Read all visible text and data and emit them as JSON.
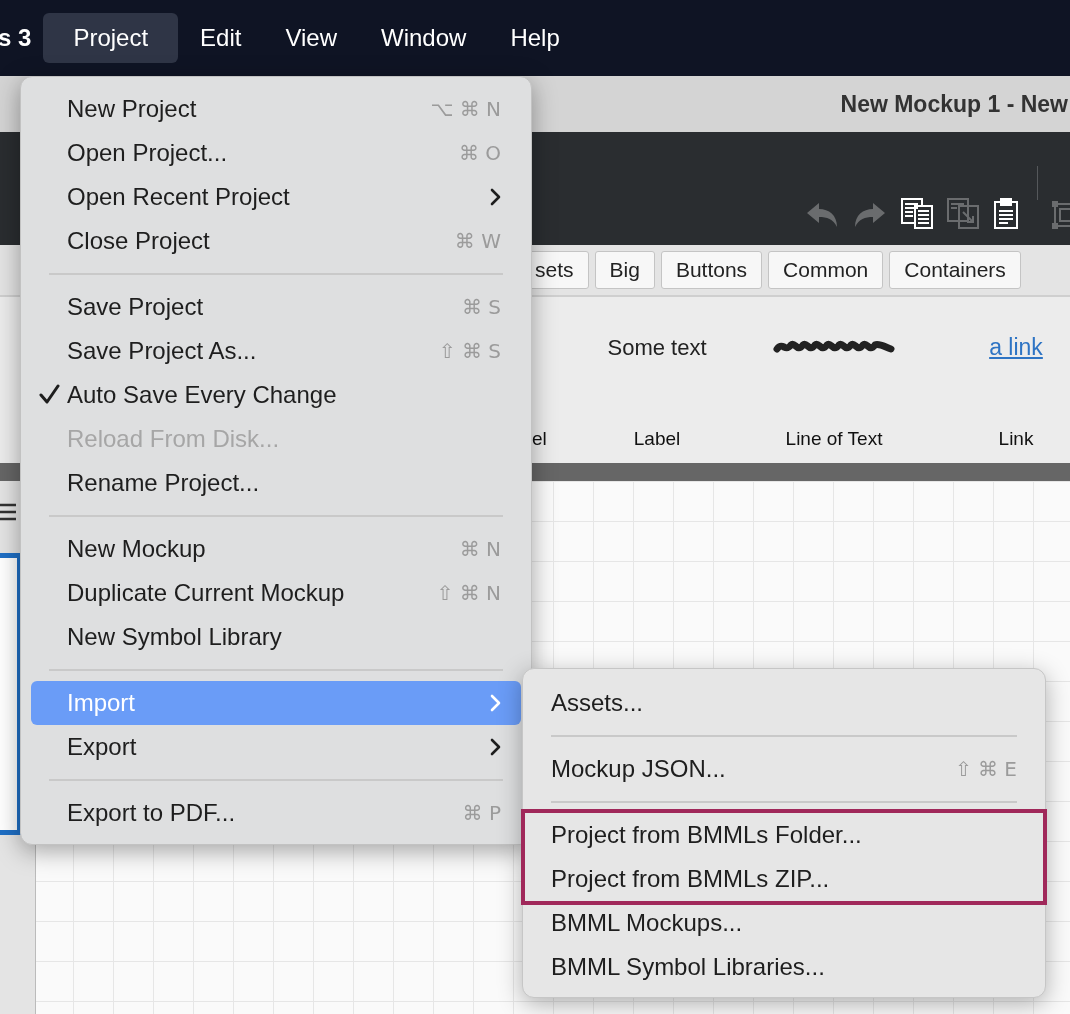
{
  "menubar": {
    "app_name": "s 3",
    "menus": [
      {
        "label": "Project",
        "selected": true
      },
      {
        "label": "Edit",
        "selected": false
      },
      {
        "label": "View",
        "selected": false
      },
      {
        "label": "Window",
        "selected": false
      },
      {
        "label": "Help",
        "selected": false
      }
    ]
  },
  "window": {
    "title": "New Mockup 1 - New"
  },
  "toolbar": {
    "tools": [
      {
        "kind": "undo",
        "disabled": true
      },
      {
        "kind": "redo",
        "disabled": true
      },
      {
        "kind": "copy",
        "disabled": false
      },
      {
        "kind": "duplicate",
        "disabled": true
      },
      {
        "kind": "paste",
        "disabled": false
      },
      {
        "kind": "separator"
      },
      {
        "kind": "group",
        "disabled": true
      }
    ]
  },
  "library_tabs": [
    {
      "label": "sets"
    },
    {
      "label": "Big"
    },
    {
      "label": "Buttons"
    },
    {
      "label": "Common"
    },
    {
      "label": "Containers"
    }
  ],
  "components": [
    {
      "kind": "hidden",
      "name": "el"
    },
    {
      "kind": "label",
      "preview": "Some text",
      "name": "Label"
    },
    {
      "kind": "line_of_text",
      "name": "Line of Text"
    },
    {
      "kind": "link",
      "preview": "a link",
      "name": "Link"
    }
  ],
  "project_menu": {
    "items": [
      {
        "kind": "item",
        "label": "New Project",
        "shortcut": "⌥ ⌘ N",
        "submenu": false,
        "checked": false,
        "disabled": false,
        "selected": false
      },
      {
        "kind": "item",
        "label": "Open Project...",
        "shortcut": "⌘ O",
        "submenu": false,
        "checked": false,
        "disabled": false,
        "selected": false
      },
      {
        "kind": "item",
        "label": "Open Recent Project",
        "submenu": true,
        "checked": false,
        "disabled": false,
        "selected": false
      },
      {
        "kind": "item",
        "label": "Close Project",
        "shortcut": "⌘ W",
        "submenu": false,
        "checked": false,
        "disabled": false,
        "selected": false
      },
      {
        "kind": "separator"
      },
      {
        "kind": "item",
        "label": "Save Project",
        "shortcut": "⌘ S",
        "submenu": false,
        "checked": false,
        "disabled": false,
        "selected": false
      },
      {
        "kind": "item",
        "label": "Save Project As...",
        "shortcut": "⇧ ⌘ S",
        "submenu": false,
        "checked": false,
        "disabled": false,
        "selected": false
      },
      {
        "kind": "item",
        "label": "Auto Save Every Change",
        "submenu": false,
        "checked": true,
        "disabled": false,
        "selected": false
      },
      {
        "kind": "item",
        "label": "Reload From Disk...",
        "submenu": false,
        "checked": false,
        "disabled": true,
        "selected": false
      },
      {
        "kind": "item",
        "label": "Rename Project...",
        "submenu": false,
        "checked": false,
        "disabled": false,
        "selected": false
      },
      {
        "kind": "separator"
      },
      {
        "kind": "item",
        "label": "New Mockup",
        "shortcut": "⌘ N",
        "submenu": false,
        "checked": false,
        "disabled": false,
        "selected": false
      },
      {
        "kind": "item",
        "label": "Duplicate Current Mockup",
        "shortcut": "⇧ ⌘ N",
        "submenu": false,
        "checked": false,
        "disabled": false,
        "selected": false
      },
      {
        "kind": "item",
        "label": "New Symbol Library",
        "submenu": false,
        "checked": false,
        "disabled": false,
        "selected": false
      },
      {
        "kind": "separator"
      },
      {
        "kind": "item",
        "label": "Import",
        "submenu": true,
        "checked": false,
        "disabled": false,
        "selected": true
      },
      {
        "kind": "item",
        "label": "Export",
        "submenu": true,
        "checked": false,
        "disabled": false,
        "selected": false
      },
      {
        "kind": "separator"
      },
      {
        "kind": "item",
        "label": "Export to PDF...",
        "shortcut": "⌘ P",
        "submenu": false,
        "checked": false,
        "disabled": false,
        "selected": false
      }
    ]
  },
  "import_submenu": {
    "items": [
      {
        "kind": "item",
        "label": "Assets...",
        "highlighted": false,
        "selected": false
      },
      {
        "kind": "separator"
      },
      {
        "kind": "item",
        "label": "Mockup JSON...",
        "shortcut": "⇧ ⌘ E",
        "highlighted": false,
        "selected": false
      },
      {
        "kind": "separator"
      },
      {
        "kind": "item",
        "label": "Project from BMMLs Folder...",
        "highlighted": true,
        "selected": false
      },
      {
        "kind": "item",
        "label": "Project from BMMLs ZIP...",
        "highlighted": true,
        "selected": false
      },
      {
        "kind": "item",
        "label": "BMML Mockups...",
        "highlighted": false,
        "selected": false
      },
      {
        "kind": "item",
        "label": "BMML Symbol Libraries...",
        "highlighted": false,
        "selected": false
      }
    ]
  }
}
